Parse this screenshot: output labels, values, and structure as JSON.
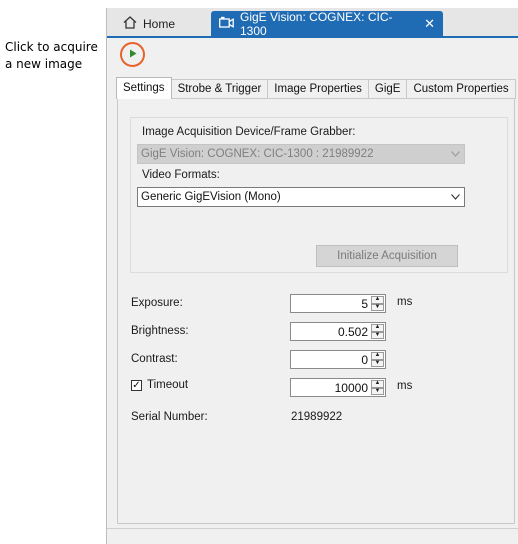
{
  "callout": {
    "line1": "Click to acquire",
    "line2": "a new image"
  },
  "window": {
    "tabs": [
      {
        "label": "Home",
        "icon": "home-icon"
      },
      {
        "label": "GigE Vision: COGNEX: CIC-1300",
        "icon": "camera-icon",
        "close": "✕"
      }
    ]
  },
  "toolbar": {
    "play_icon": "play-icon",
    "accent": "#e8632b"
  },
  "subtabs": [
    "Settings",
    "Strobe & Trigger",
    "Image Properties",
    "GigE",
    "Custom Properties"
  ],
  "settings": {
    "device_label": "Image Acquisition Device/Frame Grabber:",
    "device_value": "GigE Vision: COGNEX: CIC-1300 : 21989922",
    "video_formats_label": "Video Formats:",
    "video_formats_value": "Generic GigEVision (Mono)",
    "initialize_button": "Initialize Acquisition",
    "fields": [
      {
        "label": "Exposure:",
        "value": "5",
        "unit": "ms"
      },
      {
        "label": "Brightness:",
        "value": "0.502",
        "unit": ""
      },
      {
        "label": "Contrast:",
        "value": "0",
        "unit": ""
      },
      {
        "label": "Timeout",
        "value": "10000",
        "unit": "ms",
        "checked": true
      }
    ],
    "serial_label": "Serial Number:",
    "serial_value": "21989922"
  },
  "colors": {
    "tab_active": "#1f6cb5",
    "play_green": "#2e8b2e"
  }
}
